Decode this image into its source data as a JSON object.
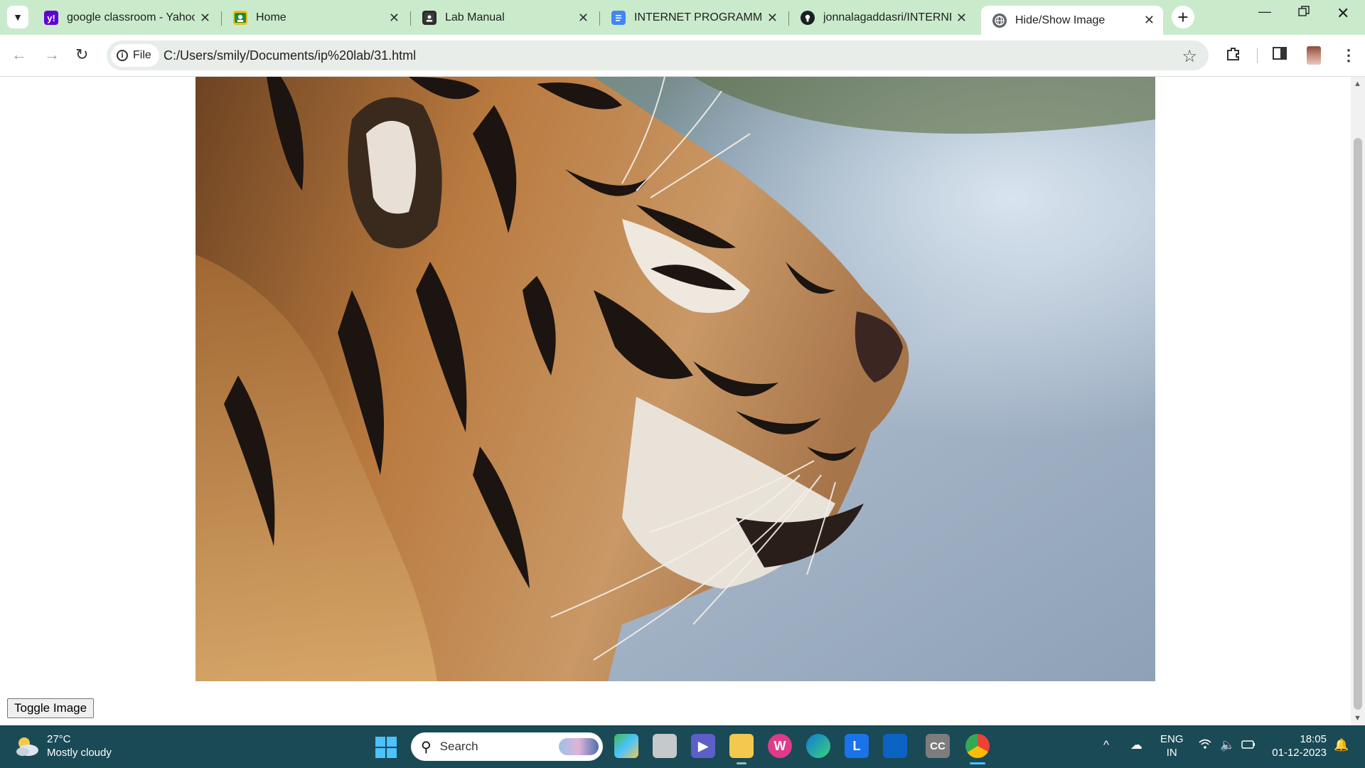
{
  "browser": {
    "tabs": [
      {
        "title": "google classroom - Yahoo",
        "icon": "yahoo-icon"
      },
      {
        "title": "Home",
        "icon": "classroom-icon"
      },
      {
        "title": "Lab Manual",
        "icon": "classroom-icon"
      },
      {
        "title": "INTERNET PROGRAMMIN",
        "icon": "docs-icon"
      },
      {
        "title": "jonnalagaddasri/INTERNE",
        "icon": "github-icon"
      },
      {
        "title": "Hide/Show Image",
        "icon": "globe-icon",
        "active": true
      }
    ],
    "address": {
      "scheme_chip": "File",
      "url": "C:/Users/smily/Documents/ip%20lab/31.html"
    }
  },
  "page": {
    "image_alt": "tiger",
    "toggle_button_label": "Toggle Image"
  },
  "taskbar": {
    "weather": {
      "temp": "27°C",
      "condition": "Mostly cloudy"
    },
    "search_placeholder": "Search",
    "language": {
      "line1": "ENG",
      "line2": "IN"
    },
    "clock": {
      "time": "18:05",
      "date": "01-12-2023"
    }
  },
  "colors": {
    "tabstrip": "#c9ebcc",
    "taskbar": "#1a4a55",
    "accent": "#4cc2ff"
  }
}
